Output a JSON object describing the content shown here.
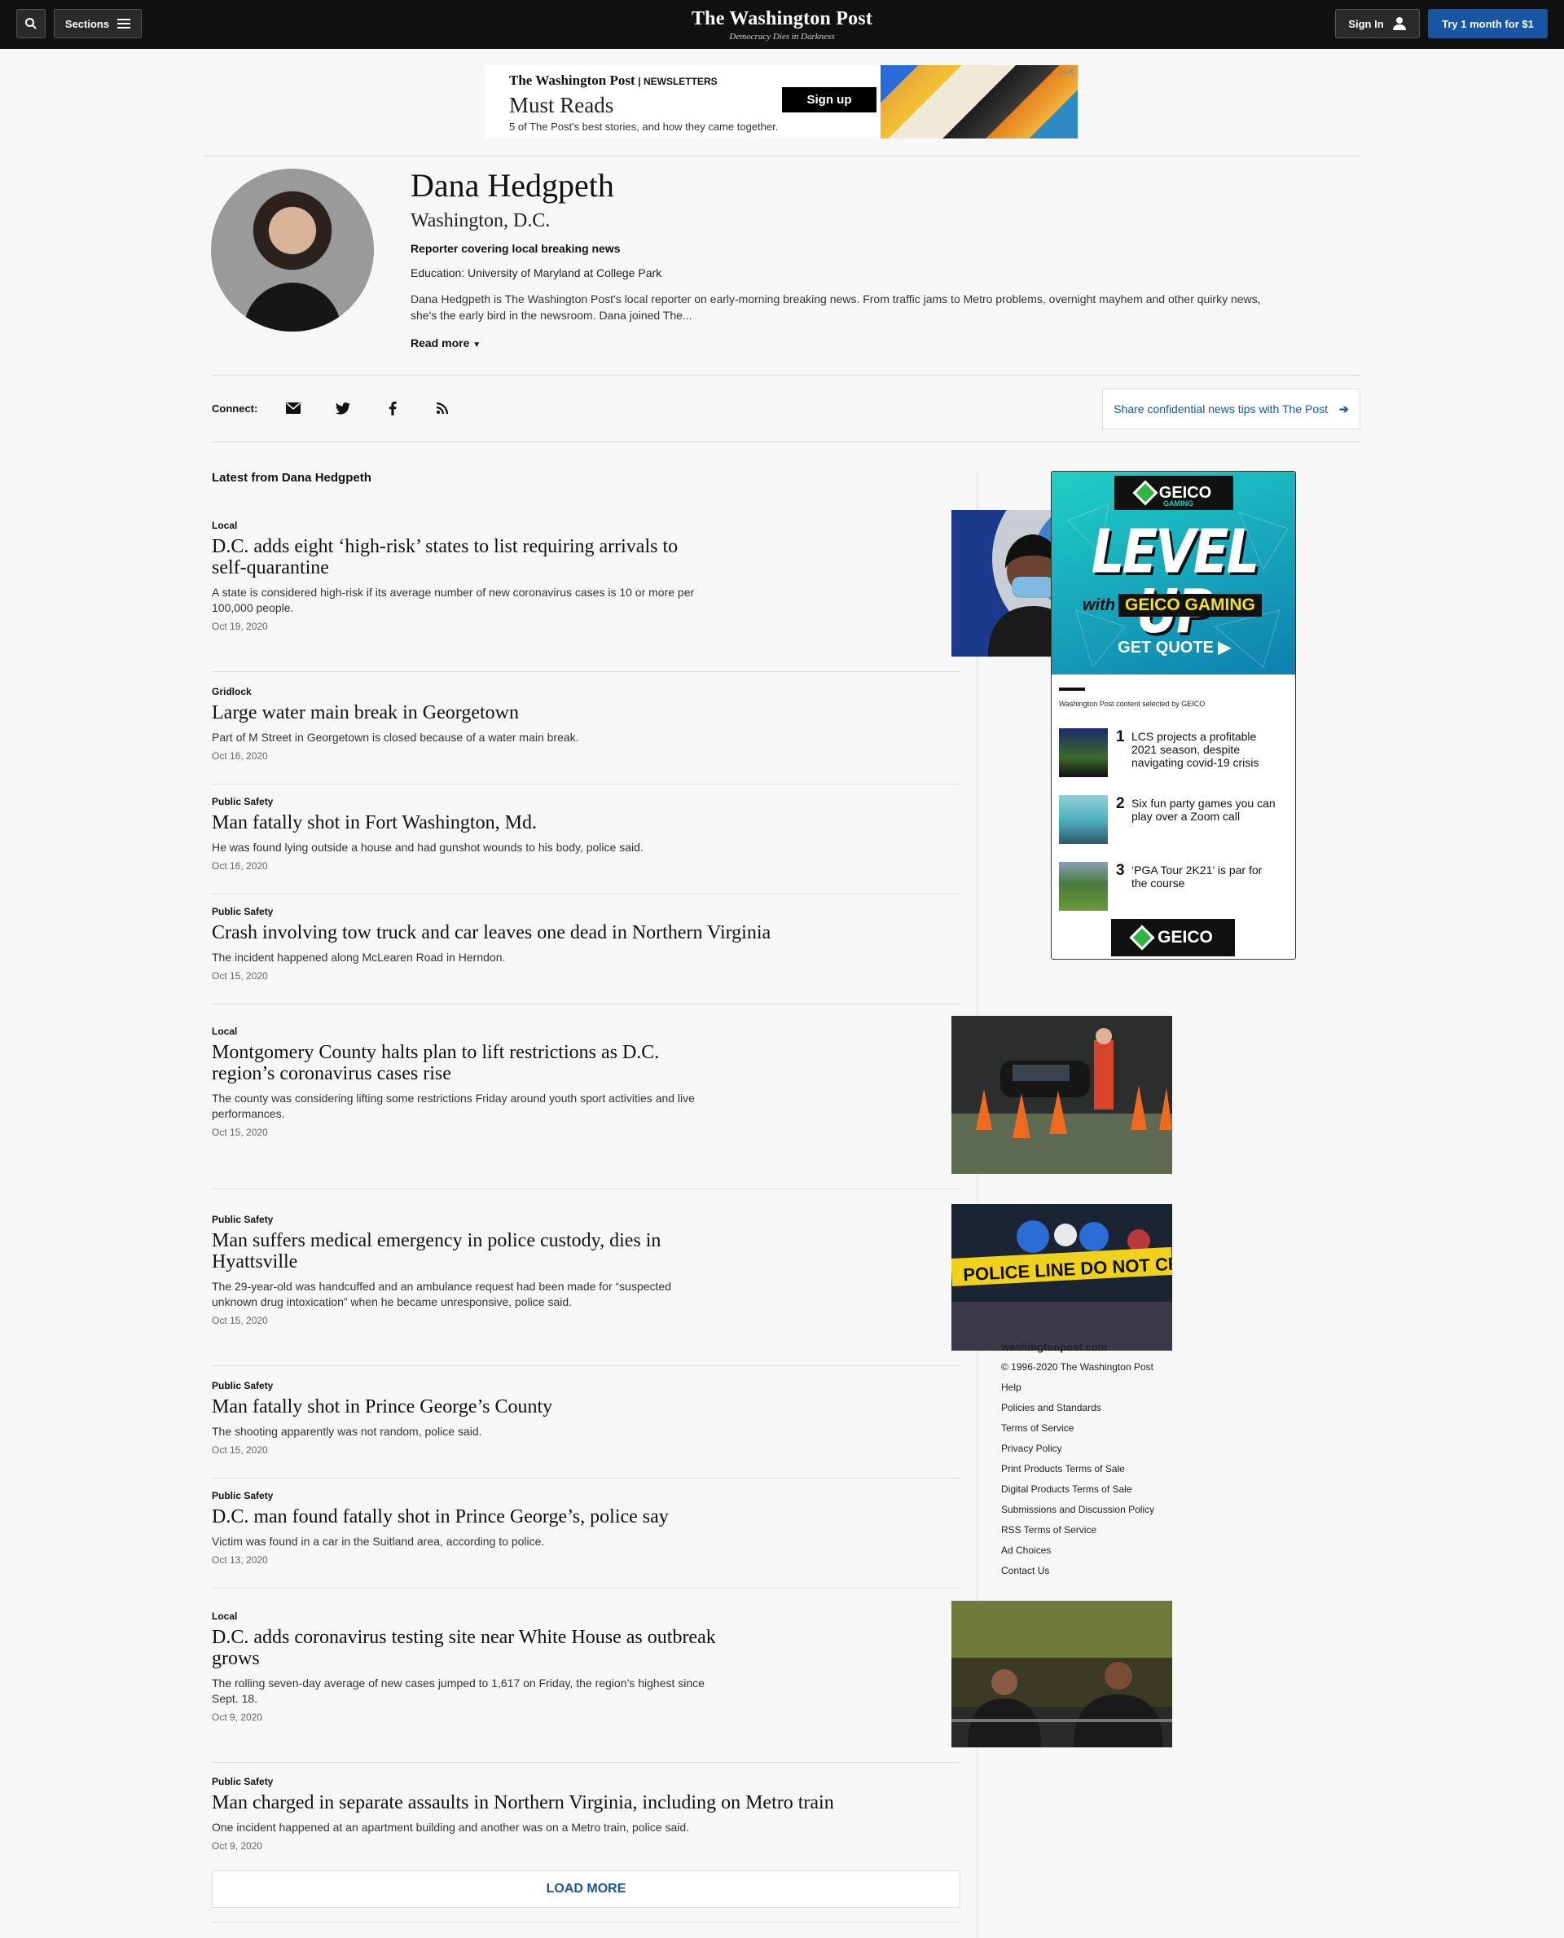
{
  "nav": {
    "sections_label": "Sections",
    "logo": "The Washington Post",
    "tagline": "Democracy Dies in Darkness",
    "signin_label": "Sign In",
    "trial_label": "Try 1 month for $1"
  },
  "newsletter_ad": {
    "brand": "The Washington Post",
    "brand_suffix": "| NEWSLETTERS",
    "title": "Must Reads",
    "subtitle": "5 of The Post's best stories, and how they came together.",
    "signup_label": "Sign up"
  },
  "profile": {
    "name": "Dana Hedgpeth",
    "location": "Washington, D.C.",
    "role": "Reporter covering local breaking news",
    "education": "Education: University of Maryland at College Park",
    "bio": "Dana Hedgpeth is The Washington Post's local reporter on early-morning breaking news. From traffic jams to Metro problems, overnight mayhem and other quirky news, she's the early bird in the newsroom. Dana joined The...",
    "read_more_label": "Read more"
  },
  "connect": {
    "label": "Connect:",
    "icons": [
      "email-icon",
      "twitter-icon",
      "facebook-icon",
      "rss-icon"
    ],
    "tips_label": "Share confidential news tips with The Post"
  },
  "stream": {
    "heading": "Latest from Dana Hedgpeth",
    "stories": [
      {
        "kicker": "Local",
        "headline": "D.C. adds eight ‘high-risk’ states to list requiring arrivals to self-quarantine",
        "blurb": "A state is considered high-risk if its average number of new coronavirus cases is 10 or more per 100,000 people.",
        "date": "Oct 19, 2020"
      },
      {
        "kicker": "Gridlock",
        "headline": "Large water main break in Georgetown",
        "blurb": "Part of M Street in Georgetown is closed because of a water main break.",
        "date": "Oct 16, 2020"
      },
      {
        "kicker": "Public Safety",
        "headline": "Man fatally shot in Fort Washington, Md.",
        "blurb": "He was found lying outside a house and had gunshot wounds to his body, police said.",
        "date": "Oct 16, 2020"
      },
      {
        "kicker": "Public Safety",
        "headline": "Crash involving tow truck and car leaves one dead in Northern Virginia",
        "blurb": "The incident happened along McLearen Road in Herndon.",
        "date": "Oct 15, 2020"
      },
      {
        "kicker": "Local",
        "headline": "Montgomery County halts plan to lift restrictions as D.C. region’s coronavirus cases rise",
        "blurb": "The county was considering lifting some restrictions Friday around youth sport activities and live performances.",
        "date": "Oct 15, 2020"
      },
      {
        "kicker": "Public Safety",
        "headline": "Man suffers medical emergency in police custody, dies in Hyattsville",
        "blurb": "The 29-year-old was handcuffed and an ambulance request had been made for “suspected unknown drug intoxication” when he became unresponsive, police said.",
        "date": "Oct 15, 2020"
      },
      {
        "kicker": "Public Safety",
        "headline": "Man fatally shot in Prince George’s County",
        "blurb": "The shooting apparently was not random, police said.",
        "date": "Oct 15, 2020"
      },
      {
        "kicker": "Public Safety",
        "headline": "D.C. man found fatally shot in Prince George’s, police say",
        "blurb": "Victim was found in a car in the Suitland area, according to police.",
        "date": "Oct 13, 2020"
      },
      {
        "kicker": "Local",
        "headline": "D.C. adds coronavirus testing site near White House as outbreak grows",
        "blurb": "The rolling seven-day average of new cases jumped to 1,617 on Friday, the region’s highest since Sept. 18.",
        "date": "Oct 9, 2020"
      },
      {
        "kicker": "Public Safety",
        "headline": "Man charged in separate assaults in Northern Virginia, including on Metro train",
        "blurb": "One incident happened at an apartment building and another was on a Metro train, police said.",
        "date": "Oct 9, 2020"
      }
    ],
    "load_more_label": "LOAD MORE"
  },
  "police_tape_text": "POLICE LINE DO NOT CROSS",
  "geico_ad": {
    "logo": "GEICO",
    "logo_sub": "GAMING",
    "headline": "LEVEL UP",
    "with": "with",
    "brand_line": "GEICO GAMING",
    "cta": "GET QUOTE ▶",
    "selected_by": "Washington Post content selected by GEICO",
    "items": [
      {
        "num": "1",
        "text": "LCS projects a profitable 2021 season, despite navigating covid-19 crisis"
      },
      {
        "num": "2",
        "text": "Six fun party games you can play over a Zoom call"
      },
      {
        "num": "3",
        "text": "‘PGA Tour 2K21’ is par for the course"
      }
    ]
  },
  "footer": {
    "site": "washingtonpost.com",
    "copyright": "© 1996-2020 The Washington Post",
    "links": [
      "Help",
      "Policies and Standards",
      "Terms of Service",
      "Privacy Policy",
      "Print Products Terms of Sale",
      "Digital Products Terms of Sale",
      "Submissions and Discussion Policy",
      "RSS Terms of Service",
      "Ad Choices",
      "Contact Us"
    ]
  },
  "colors": {
    "accent": "#1955a5",
    "nav_bg": "#111111",
    "page_bg": "#f7f7f7"
  }
}
